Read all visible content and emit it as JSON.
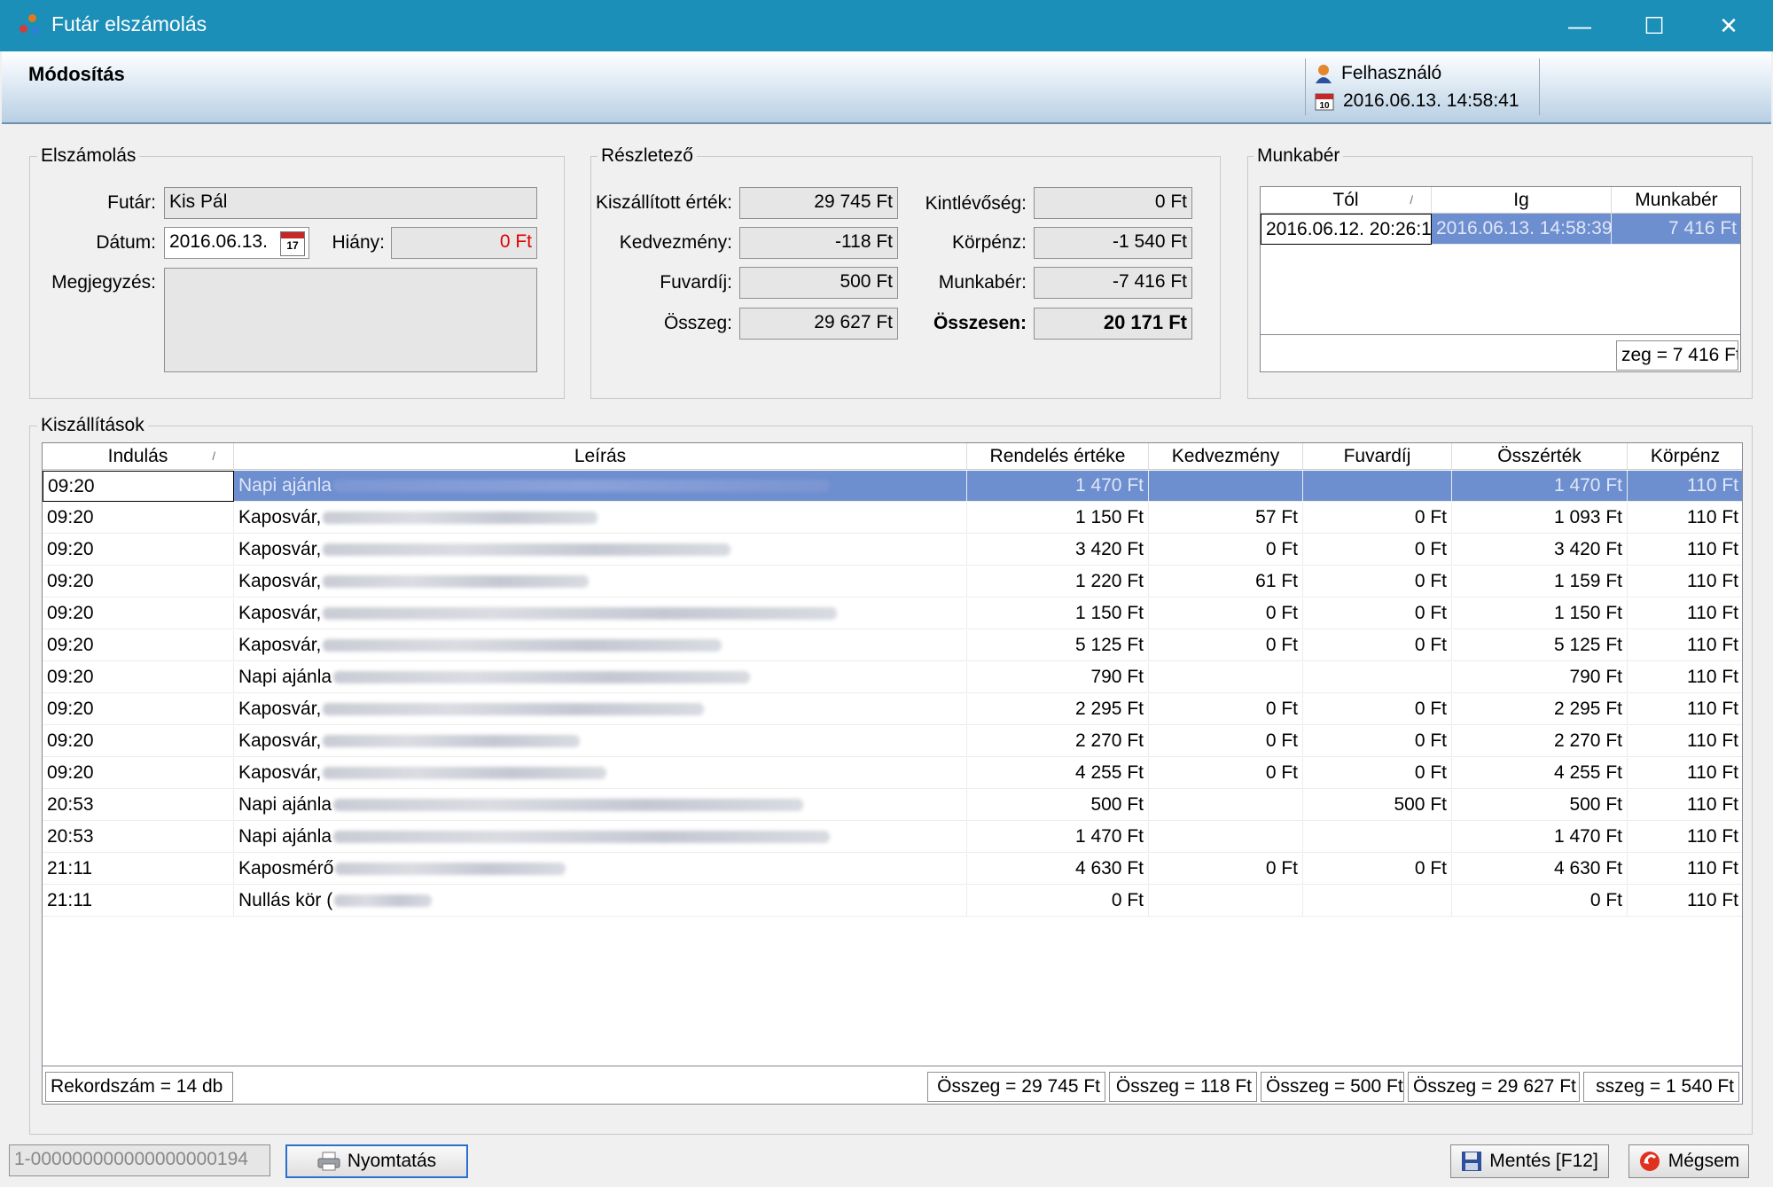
{
  "window": {
    "title": "Futár elszámolás",
    "minimize": "—",
    "maximize": "☐",
    "close": "✕"
  },
  "header": {
    "mode": "Módosítás",
    "user_label": "Felhasználó",
    "datetime": "2016.06.13.  14:58:41"
  },
  "elszamolas": {
    "title": "Elszámolás",
    "futar_label": "Futár:",
    "futar_value": "Kis Pál",
    "datum_label": "Dátum:",
    "datum_value": "2016.06.13.",
    "calendar_day": "17",
    "hiany_label": "Hiány:",
    "hiany_value": "0 Ft",
    "megjegyzes_label": "Megjegyzés:"
  },
  "reszletezo": {
    "title": "Részletező",
    "kiszallitott_label": "Kiszállított érték:",
    "kiszallitott_value": "29 745 Ft",
    "kedvezmeny_label": "Kedvezmény:",
    "kedvezmeny_value": "-118 Ft",
    "fuvardij_label": "Fuvardíj:",
    "fuvardij_value": "500 Ft",
    "osszeg_label": "Összeg:",
    "osszeg_value": "29 627 Ft",
    "kintlevoseg_label": "Kintlévőség:",
    "kintlevoseg_value": "0 Ft",
    "korpenz_label": "Körpénz:",
    "korpenz_value": "-1 540 Ft",
    "munkaber_label": "Munkabér:",
    "munkaber_value": "-7 416 Ft",
    "osszesen_label": "Összesen:",
    "osszesen_value": "20 171 Ft"
  },
  "munkaber": {
    "title": "Munkabér",
    "columns": [
      "Tól",
      "Ig",
      "Munkabér"
    ],
    "sort_mark": "/",
    "row": {
      "tol": "2016.06.12. 20:26:1",
      "ig": "2016.06.13. 14:58:39",
      "munkaber": "7 416 Ft"
    },
    "footer": "zeg = 7 416 Ft"
  },
  "kiszallitasok": {
    "title": "Kiszállítások",
    "columns": [
      "Indulás",
      "Leírás",
      "Rendelés értéke",
      "Kedvezmény",
      "Fuvardíj",
      "Összérték",
      "Körpénz"
    ],
    "sort_mark": "/",
    "rows": [
      {
        "indulas": "09:20",
        "leiras": "Napi ajánla",
        "rendeles": "1 470 Ft",
        "kedvezmeny": "",
        "fuvardij": "",
        "osszertek": "1 470 Ft",
        "korpenz": "110 Ft"
      },
      {
        "indulas": "09:20",
        "leiras": "Kaposvár,",
        "rendeles": "1 150 Ft",
        "kedvezmeny": "57 Ft",
        "fuvardij": "0 Ft",
        "osszertek": "1 093 Ft",
        "korpenz": "110 Ft"
      },
      {
        "indulas": "09:20",
        "leiras": "Kaposvár,",
        "rendeles": "3 420 Ft",
        "kedvezmeny": "0 Ft",
        "fuvardij": "0 Ft",
        "osszertek": "3 420 Ft",
        "korpenz": "110 Ft"
      },
      {
        "indulas": "09:20",
        "leiras": "Kaposvár,",
        "rendeles": "1 220 Ft",
        "kedvezmeny": "61 Ft",
        "fuvardij": "0 Ft",
        "osszertek": "1 159 Ft",
        "korpenz": "110 Ft"
      },
      {
        "indulas": "09:20",
        "leiras": "Kaposvár,",
        "rendeles": "1 150 Ft",
        "kedvezmeny": "0 Ft",
        "fuvardij": "0 Ft",
        "osszertek": "1 150 Ft",
        "korpenz": "110 Ft"
      },
      {
        "indulas": "09:20",
        "leiras": "Kaposvár,",
        "rendeles": "5 125 Ft",
        "kedvezmeny": "0 Ft",
        "fuvardij": "0 Ft",
        "osszertek": "5 125 Ft",
        "korpenz": "110 Ft"
      },
      {
        "indulas": "09:20",
        "leiras": "Napi ajánla",
        "rendeles": "790 Ft",
        "kedvezmeny": "",
        "fuvardij": "",
        "osszertek": "790 Ft",
        "korpenz": "110 Ft"
      },
      {
        "indulas": "09:20",
        "leiras": "Kaposvár,",
        "rendeles": "2 295 Ft",
        "kedvezmeny": "0 Ft",
        "fuvardij": "0 Ft",
        "osszertek": "2 295 Ft",
        "korpenz": "110 Ft"
      },
      {
        "indulas": "09:20",
        "leiras": "Kaposvár,",
        "rendeles": "2 270 Ft",
        "kedvezmeny": "0 Ft",
        "fuvardij": "0 Ft",
        "osszertek": "2 270 Ft",
        "korpenz": "110 Ft"
      },
      {
        "indulas": "09:20",
        "leiras": "Kaposvár,",
        "rendeles": "4 255 Ft",
        "kedvezmeny": "0 Ft",
        "fuvardij": "0 Ft",
        "osszertek": "4 255 Ft",
        "korpenz": "110 Ft"
      },
      {
        "indulas": "20:53",
        "leiras": "Napi ajánla",
        "rendeles": "500 Ft",
        "kedvezmeny": "",
        "fuvardij": "500 Ft",
        "osszertek": "500 Ft",
        "korpenz": "110 Ft"
      },
      {
        "indulas": "20:53",
        "leiras": "Napi ajánla",
        "rendeles": "1 470 Ft",
        "kedvezmeny": "",
        "fuvardij": "",
        "osszertek": "1 470 Ft",
        "korpenz": "110 Ft"
      },
      {
        "indulas": "21:11",
        "leiras": "Kaposmérő",
        "rendeles": "4 630 Ft",
        "kedvezmeny": "0 Ft",
        "fuvardij": "0 Ft",
        "osszertek": "4 630 Ft",
        "korpenz": "110 Ft"
      },
      {
        "indulas": "21:11",
        "leiras": "Nullás kör (",
        "rendeles": "0 Ft",
        "kedvezmeny": "",
        "fuvardij": "",
        "osszertek": "0 Ft",
        "korpenz": "110 Ft"
      }
    ],
    "footer": {
      "rekordszam": "Rekordszám = 14 db",
      "rendeles": "Összeg = 29 745 Ft",
      "kedvezmeny": "Összeg = 118 Ft",
      "fuvardij": "Összeg = 500 Ft",
      "osszertek": "Összeg = 29 627 Ft",
      "korpenz": "sszeg = 1 540 Ft"
    }
  },
  "bottom": {
    "id_value": "1-000000000000000000194",
    "print_label": "Nyomtatás",
    "save_label": "Mentés [F12]",
    "cancel_label": "Mégsem"
  },
  "colors": {
    "titlebar": "#1b8fb8",
    "selection": "#6d8ecf",
    "negative": "#e00000"
  }
}
